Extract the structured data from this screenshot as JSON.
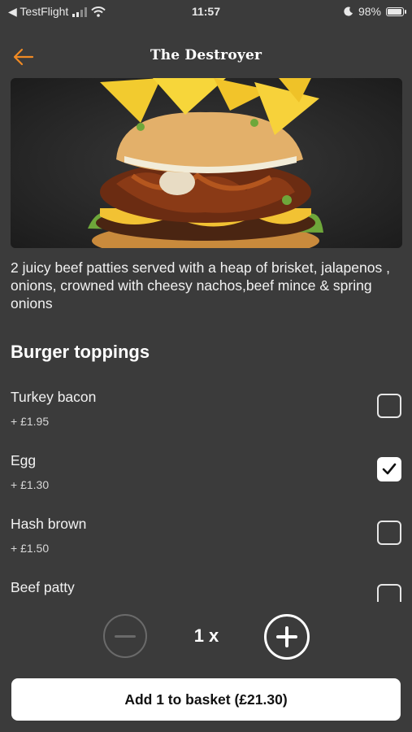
{
  "status_bar": {
    "back_app": "◀ TestFlight",
    "time": "11:57",
    "battery_text": "98%",
    "battery_level": 0.98
  },
  "header": {
    "title": "The Destroyer",
    "accent_color": "#f08a24"
  },
  "hero_image": {
    "subject": "burger with brisket, nachos and toppings"
  },
  "description": "2 juicy beef patties served with a heap of brisket, jalapenos , onions, crowned with cheesy nachos,beef mince & spring onions",
  "toppings": {
    "section_title": "Burger toppings",
    "items": [
      {
        "name": "Turkey bacon",
        "price": "+ £1.95",
        "checked": false
      },
      {
        "name": "Egg",
        "price": "+ £1.30",
        "checked": true
      },
      {
        "name": "Hash brown",
        "price": "+ £1.50",
        "checked": false
      },
      {
        "name": "Beef patty",
        "checked": false
      }
    ]
  },
  "quantity": {
    "value_label": "1 x"
  },
  "add_button": {
    "label": "Add 1 to basket (£21.30)"
  }
}
